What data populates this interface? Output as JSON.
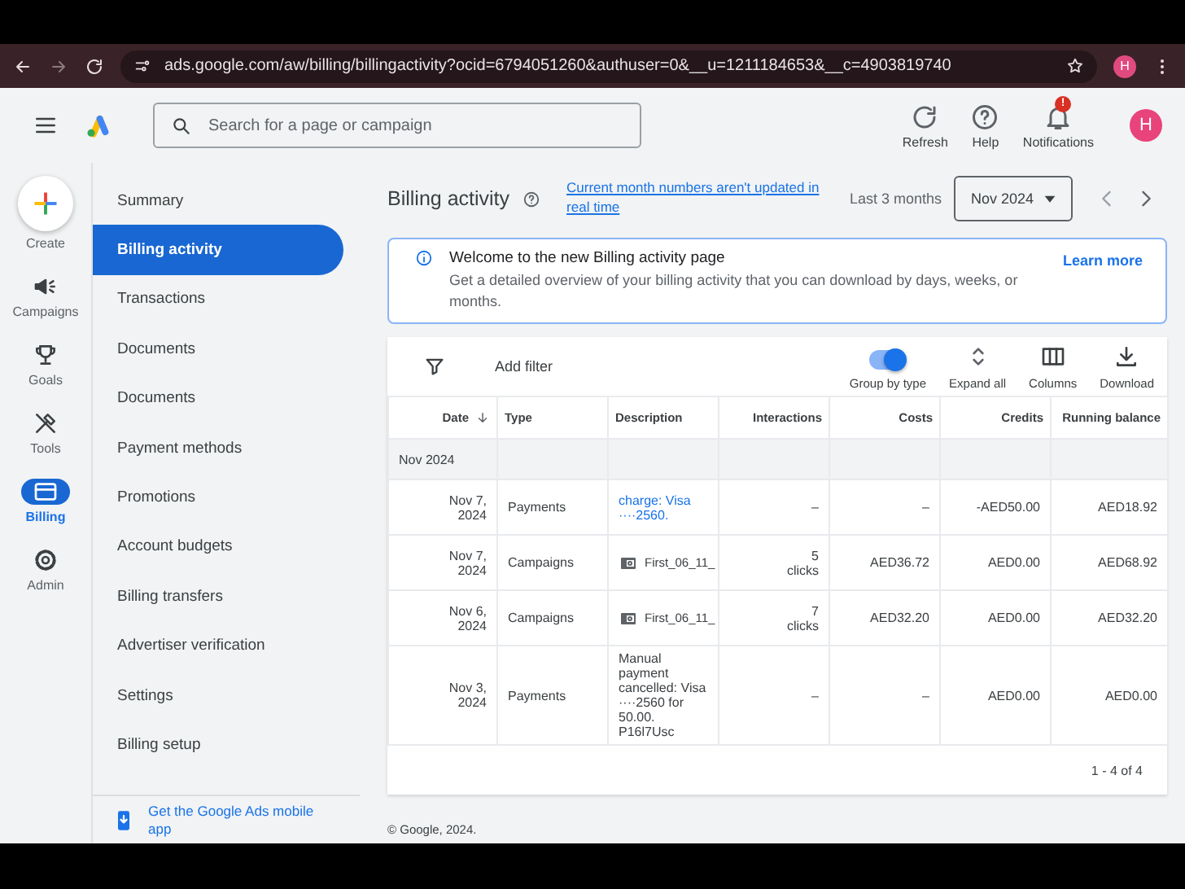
{
  "browser": {
    "url": "ads.google.com/aw/billing/billingactivity?ocid=6794051260&authuser=0&__u=1211184653&__c=4903819740",
    "avatar": "H"
  },
  "header": {
    "search_placeholder": "Search for a page or campaign",
    "actions": [
      {
        "kind": "refresh",
        "label": "Refresh"
      },
      {
        "kind": "help",
        "label": "Help"
      },
      {
        "kind": "notifications",
        "label": "Notifications",
        "badge": "!"
      }
    ],
    "avatar": "H"
  },
  "rail": [
    {
      "kind": "create",
      "label": "Create",
      "selected": false
    },
    {
      "kind": "campaigns",
      "label": "Campaigns",
      "selected": false
    },
    {
      "kind": "goals",
      "label": "Goals",
      "selected": false
    },
    {
      "kind": "tools",
      "label": "Tools",
      "selected": false
    },
    {
      "kind": "billing",
      "label": "Billing",
      "selected": true
    },
    {
      "kind": "admin",
      "label": "Admin",
      "selected": false
    }
  ],
  "sidebar": {
    "items": [
      {
        "label": "Summary",
        "selected": false
      },
      {
        "label": "Billing activity",
        "selected": true
      },
      {
        "label": "Transactions",
        "selected": false
      },
      {
        "label": "Documents",
        "selected": false
      },
      {
        "label": "Documents",
        "selected": false
      },
      {
        "label": "Payment methods",
        "selected": false
      },
      {
        "label": "Promotions",
        "selected": false
      },
      {
        "label": "Account budgets",
        "selected": false
      },
      {
        "label": "Billing transfers",
        "selected": false
      },
      {
        "label": "Advertiser verification",
        "selected": false
      },
      {
        "label": "Settings",
        "selected": false
      },
      {
        "label": "Billing setup",
        "selected": false
      }
    ],
    "footer_link": "Get the Google Ads mobile app"
  },
  "page": {
    "title": "Billing activity",
    "notice_link": "Current month numbers aren't updated in real time",
    "range_label": "Last 3 months",
    "month": "Nov 2024"
  },
  "banner": {
    "title": "Welcome to the new Billing activity page",
    "body": "Get a detailed overview of your billing activity that you can download by days, weeks, or months.",
    "link": "Learn more"
  },
  "toolbar": {
    "filter_label": "Add filter",
    "toggle": {
      "label": "Group by type",
      "on": true
    },
    "actions": [
      {
        "kind": "expand",
        "label": "Expand all"
      },
      {
        "kind": "columns",
        "label": "Columns"
      },
      {
        "kind": "download",
        "label": "Download"
      }
    ]
  },
  "table": {
    "columns": [
      {
        "label": "Date",
        "sorted": true
      },
      {
        "label": "Type",
        "sorted": false
      },
      {
        "label": "Description",
        "sorted": false
      },
      {
        "label": "Interactions",
        "sorted": false
      },
      {
        "label": "Costs",
        "sorted": false
      },
      {
        "label": "Credits",
        "sorted": false
      },
      {
        "label": "Running balance",
        "sorted": false
      }
    ],
    "group": "Nov 2024",
    "rows": [
      {
        "date": "Nov 7, 2024",
        "type": "Payments",
        "kind": "link",
        "description": "charge: Visa ····2560.",
        "interactions": "–",
        "costs": "–",
        "credits": "-AED50.00",
        "balance": "AED18.92"
      },
      {
        "date": "Nov 7, 2024",
        "type": "Campaigns",
        "kind": "campaign",
        "description": "First_06_11_",
        "interactions": "5 clicks",
        "costs": "AED36.72",
        "credits": "AED0.00",
        "balance": "AED68.92"
      },
      {
        "date": "Nov 6, 2024",
        "type": "Campaigns",
        "kind": "campaign",
        "description": "First_06_11_",
        "interactions": "7 clicks",
        "costs": "AED32.20",
        "credits": "AED0.00",
        "balance": "AED32.20"
      },
      {
        "date": "Nov 3, 2024",
        "type": "Payments",
        "kind": "text",
        "description": "Manual payment cancelled: Visa ····2560 for 50.00. P16l7Usc",
        "interactions": "–",
        "costs": "–",
        "credits": "AED0.00",
        "balance": "AED0.00"
      }
    ],
    "pagination": "1 - 4 of 4"
  },
  "footer": "© Google, 2024."
}
